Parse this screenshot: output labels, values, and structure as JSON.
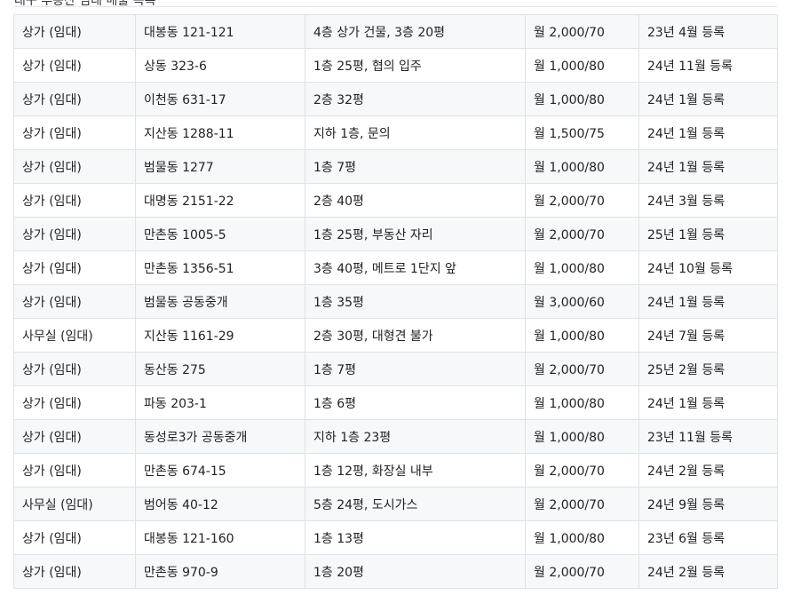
{
  "header": {
    "caption_partial": "대구 부동산 임대 매물 목록"
  },
  "table": {
    "rows": [
      {
        "type": "상가 (임대)",
        "location": "대봉동 121-121",
        "detail": "4층 상가 건물, 3층 20평",
        "price": "월 2,000/70",
        "date": "23년 4월 등록"
      },
      {
        "type": "상가 (임대)",
        "location": "상동 323-6",
        "detail": "1층 25평, 협의 입주",
        "price": "월 1,000/80",
        "date": "24년 11월 등록"
      },
      {
        "type": "상가 (임대)",
        "location": "이천동 631-17",
        "detail": "2층 32평",
        "price": "월 1,000/80",
        "date": "24년 1월 등록"
      },
      {
        "type": "상가 (임대)",
        "location": "지산동 1288-11",
        "detail": "지하 1층, 문의",
        "price": "월 1,500/75",
        "date": "24년 1월 등록"
      },
      {
        "type": "상가 (임대)",
        "location": "범물동 1277",
        "detail": "1층 7평",
        "price": "월 1,000/80",
        "date": "24년 1월 등록"
      },
      {
        "type": "상가 (임대)",
        "location": "대명동 2151-22",
        "detail": "2층 40평",
        "price": "월 2,000/70",
        "date": "24년 3월 등록"
      },
      {
        "type": "상가 (임대)",
        "location": "만촌동 1005-5",
        "detail": "1층 25평, 부동산 자리",
        "price": "월 2,000/70",
        "date": "25년 1월 등록"
      },
      {
        "type": "상가 (임대)",
        "location": "만촌동 1356-51",
        "detail": "3층 40평, 메트로 1단지 앞",
        "price": "월 1,000/80",
        "date": "24년 10월 등록"
      },
      {
        "type": "상가 (임대)",
        "location": "범물동 공동중개",
        "detail": "1층 35평",
        "price": "월 3,000/60",
        "date": "24년 1월 등록"
      },
      {
        "type": "사무실 (임대)",
        "location": "지산동 1161-29",
        "detail": "2층 30평, 대형견 불가",
        "price": "월 1,000/80",
        "date": "24년 7월 등록"
      },
      {
        "type": "상가 (임대)",
        "location": "동산동 275",
        "detail": "1층 7평",
        "price": "월 2,000/70",
        "date": "25년 2월 등록"
      },
      {
        "type": "상가 (임대)",
        "location": "파동 203-1",
        "detail": "1층 6평",
        "price": "월 1,000/80",
        "date": "24년 1월 등록"
      },
      {
        "type": "상가 (임대)",
        "location": "동성로3가 공동중개",
        "detail": "지하 1층 23평",
        "price": "월 1,000/80",
        "date": "23년 11월 등록"
      },
      {
        "type": "상가 (임대)",
        "location": "만촌동 674-15",
        "detail": "1층 12평, 화장실 내부",
        "price": "월 2,000/70",
        "date": "24년 2월 등록"
      },
      {
        "type": "사무실 (임대)",
        "location": "범어동 40-12",
        "detail": "5층 24평, 도시가스",
        "price": "월 2,000/70",
        "date": "24년 9월 등록"
      },
      {
        "type": "상가 (임대)",
        "location": "대봉동 121-160",
        "detail": "1층 13평",
        "price": "월 1,000/80",
        "date": "23년 6월 등록"
      },
      {
        "type": "상가 (임대)",
        "location": "만촌동 970-9",
        "detail": "1층 20평",
        "price": "월 2,000/70",
        "date": "24년 2월 등록"
      }
    ]
  }
}
